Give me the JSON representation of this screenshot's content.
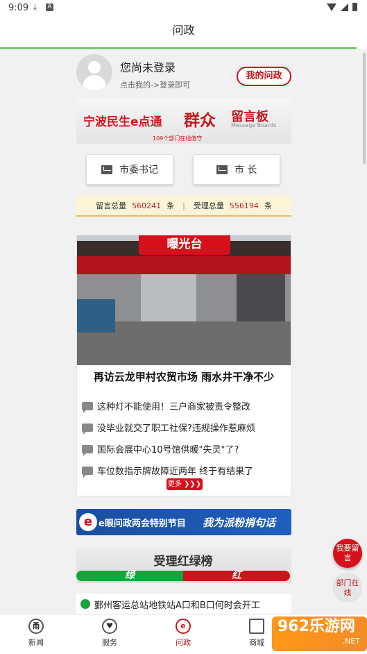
{
  "status_bar": {
    "time": "9:09",
    "download_icon": "download-icon",
    "a_icon": "A"
  },
  "header": {
    "title": "问政"
  },
  "user": {
    "name": "您尚未登录",
    "hint": "点击我的->登录即可",
    "my_button": "我的问政"
  },
  "banner_message_board": {
    "left_text": "宁波民生e点通",
    "right_big": "群众",
    "right_small": "留言板",
    "right_en": "Message Boards",
    "sub": "109个部门在线值守"
  },
  "secretaries": [
    {
      "label": "市委书记",
      "icon": "envelope-icon"
    },
    {
      "label": "市 长",
      "icon": "envelope-icon"
    }
  ],
  "stats": {
    "msg_label": "留言总量",
    "msg_value": "560241",
    "msg_unit": "条",
    "sep": "|",
    "handled_label": "受理总量",
    "handled_value": "556194",
    "handled_unit": "条"
  },
  "exposure": {
    "tag": "曝光台",
    "headline": "再访云龙甲村农贸市场 雨水井干净不少",
    "items": [
      "这种灯不能使用！三户商家被责令整改",
      "没毕业就交了职工社保?违规操作惹麻烦",
      "国际会展中心10号馆供暖\"失灵\"了?",
      "车位数指示牌故障近两年 终于有结果了"
    ],
    "more": "更多 ❯❯❯"
  },
  "banner_special": {
    "logo": "e",
    "title": "e眼问政两会特别节目",
    "slogan": "我为派粉捎句话"
  },
  "red_green": {
    "title": "受理红绿榜",
    "green": "绿",
    "red": "红",
    "first_item": "鄞州客运总站地铁站A口和B口何时会开工"
  },
  "float_buttons": {
    "leave_msg": "我要留言",
    "dept_online": "部门在线"
  },
  "tabs": [
    {
      "label": "新闻",
      "icon": "news-icon",
      "glyph": "甬"
    },
    {
      "label": "服务",
      "icon": "heart-icon",
      "glyph": "♥"
    },
    {
      "label": "问政",
      "icon": "e-icon",
      "glyph": "e"
    },
    {
      "label": "商城",
      "icon": "cart-icon",
      "glyph": "🛒"
    }
  ],
  "watermark": {
    "main": "962乐游网",
    "sub": ".NET"
  },
  "colors": {
    "brand_red": "#c7161d",
    "accent_green": "#18a43a",
    "stats_bg": "#fdf3d6"
  }
}
